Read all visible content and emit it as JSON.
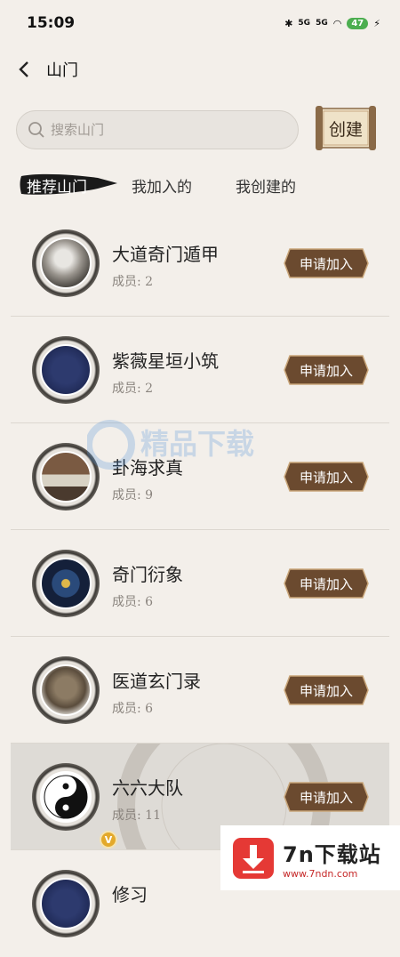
{
  "status_bar": {
    "time": "15:09",
    "battery": "47",
    "network_1": "5G",
    "network_2": "5G"
  },
  "header": {
    "title": "山门"
  },
  "search": {
    "placeholder": "搜索山门"
  },
  "create_button": {
    "label": "创建"
  },
  "tabs": [
    {
      "label": "推荐山门",
      "active": true
    },
    {
      "label": "我加入的",
      "active": false
    },
    {
      "label": "我创建的",
      "active": false
    }
  ],
  "groups": [
    {
      "name": "大道奇门遁甲",
      "members": "成员: 2",
      "join_label": "申请加入"
    },
    {
      "name": "紫薇星垣小筑",
      "members": "成员: 2",
      "join_label": "申请加入"
    },
    {
      "name": "卦海求真",
      "members": "成员: 9",
      "join_label": "申请加入"
    },
    {
      "name": "奇门衍象",
      "members": "成员: 6",
      "join_label": "申请加入"
    },
    {
      "name": "医道玄门录",
      "members": "成员: 6",
      "join_label": "申请加入"
    },
    {
      "name": "六六大队",
      "members": "成员: 11",
      "join_label": "申请加入",
      "badge": "V"
    },
    {
      "name": "修习",
      "members": "",
      "join_label": ""
    }
  ],
  "watermark": {
    "text": "精品下载"
  },
  "ad": {
    "title": "7n下载站",
    "url": "www.7ndn.com"
  },
  "colors": {
    "accent_brown": "#6b4a2f",
    "background": "#f3efea"
  }
}
